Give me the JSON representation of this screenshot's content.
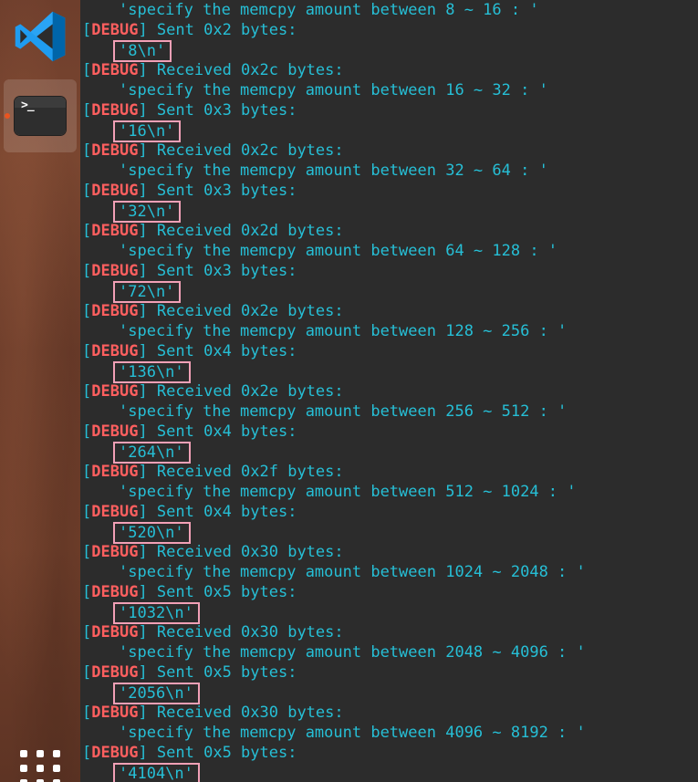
{
  "dock": {
    "apps": [
      {
        "name": "Visual Studio Code",
        "icon": "vscode-icon"
      },
      {
        "name": "Terminal",
        "icon": "terminal-icon",
        "running": true
      }
    ],
    "terminal_prompt": ">_",
    "show_apps_icon": "app-grid-icon"
  },
  "colors": {
    "text": "#26bfd6",
    "debug_tag": "#ff5f5f",
    "highlight_box": "#f2a0b6",
    "terminal_bg": "#2c2c2c",
    "running_dot": "#e95420"
  },
  "terminal": {
    "tag": "DEBUG",
    "lines": [
      {
        "kind": "text",
        "text": "'specify the memcpy amount between 8 ~ 16 : '"
      },
      {
        "kind": "debug",
        "message": "Sent 0x2 bytes:"
      },
      {
        "kind": "value",
        "text": "'8\\n'"
      },
      {
        "kind": "debug",
        "message": "Received 0x2c bytes:"
      },
      {
        "kind": "text",
        "text": "'specify the memcpy amount between 16 ~ 32 : '"
      },
      {
        "kind": "debug",
        "message": "Sent 0x3 bytes:"
      },
      {
        "kind": "value",
        "text": "'16\\n'"
      },
      {
        "kind": "debug",
        "message": "Received 0x2c bytes:"
      },
      {
        "kind": "text",
        "text": "'specify the memcpy amount between 32 ~ 64 : '"
      },
      {
        "kind": "debug",
        "message": "Sent 0x3 bytes:"
      },
      {
        "kind": "value",
        "text": "'32\\n'"
      },
      {
        "kind": "debug",
        "message": "Received 0x2d bytes:"
      },
      {
        "kind": "text",
        "text": "'specify the memcpy amount between 64 ~ 128 : '"
      },
      {
        "kind": "debug",
        "message": "Sent 0x3 bytes:"
      },
      {
        "kind": "value",
        "text": "'72\\n'"
      },
      {
        "kind": "debug",
        "message": "Received 0x2e bytes:"
      },
      {
        "kind": "text",
        "text": "'specify the memcpy amount between 128 ~ 256 : '"
      },
      {
        "kind": "debug",
        "message": "Sent 0x4 bytes:"
      },
      {
        "kind": "value",
        "text": "'136\\n'"
      },
      {
        "kind": "debug",
        "message": "Received 0x2e bytes:"
      },
      {
        "kind": "text",
        "text": "'specify the memcpy amount between 256 ~ 512 : '"
      },
      {
        "kind": "debug",
        "message": "Sent 0x4 bytes:"
      },
      {
        "kind": "value",
        "text": "'264\\n'"
      },
      {
        "kind": "debug",
        "message": "Received 0x2f bytes:"
      },
      {
        "kind": "text",
        "text": "'specify the memcpy amount between 512 ~ 1024 : '"
      },
      {
        "kind": "debug",
        "message": "Sent 0x4 bytes:"
      },
      {
        "kind": "value",
        "text": "'520\\n'"
      },
      {
        "kind": "debug",
        "message": "Received 0x30 bytes:"
      },
      {
        "kind": "text",
        "text": "'specify the memcpy amount between 1024 ~ 2048 : '"
      },
      {
        "kind": "debug",
        "message": "Sent 0x5 bytes:"
      },
      {
        "kind": "value",
        "text": "'1032\\n'"
      },
      {
        "kind": "debug",
        "message": "Received 0x30 bytes:"
      },
      {
        "kind": "text",
        "text": "'specify the memcpy amount between 2048 ~ 4096 : '"
      },
      {
        "kind": "debug",
        "message": "Sent 0x5 bytes:"
      },
      {
        "kind": "value",
        "text": "'2056\\n'"
      },
      {
        "kind": "debug",
        "message": "Received 0x30 bytes:"
      },
      {
        "kind": "text",
        "text": "'specify the memcpy amount between 4096 ~ 8192 : '"
      },
      {
        "kind": "debug",
        "message": "Sent 0x5 bytes:"
      },
      {
        "kind": "value",
        "text": "'4104\\n'"
      }
    ]
  }
}
